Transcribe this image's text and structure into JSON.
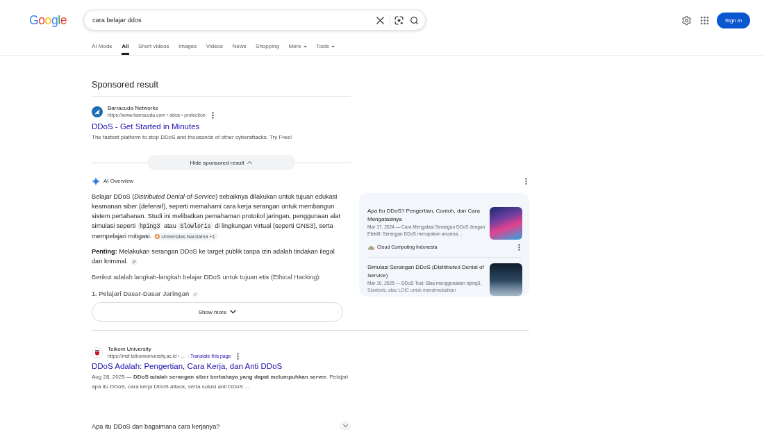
{
  "header": {
    "logo": "Google",
    "search": {
      "value": "cara belajar ddos"
    },
    "sign_in": "Sign in"
  },
  "tabs": [
    {
      "label": "AI Mode",
      "kind": "link",
      "selected": false
    },
    {
      "label": "All",
      "kind": "link",
      "selected": true
    },
    {
      "label": "Short videos",
      "kind": "link",
      "selected": false
    },
    {
      "label": "Images",
      "kind": "link",
      "selected": false
    },
    {
      "label": "Videos",
      "kind": "link",
      "selected": false
    },
    {
      "label": "News",
      "kind": "link",
      "selected": false
    },
    {
      "label": "Shopping",
      "kind": "link",
      "selected": false
    },
    {
      "label": "More",
      "kind": "menu",
      "selected": false
    },
    {
      "label": "Tools",
      "kind": "menu",
      "selected": false
    }
  ],
  "sponsored": {
    "heading": "Sponsored result",
    "ad": {
      "site": "Barracuda Networks",
      "url": "https://www.barracuda.com › ddos › protection",
      "title": "DDoS - Get Started in Minutes",
      "description": "The fastest platform to stop DDoS and thousands of other cyberattacks. Try Free!"
    },
    "hide_button": {
      "label": "Hide sponsored result",
      "expanded": true
    }
  },
  "ai_overview": {
    "title": "AI Overview",
    "expanded": false,
    "blocks": [
      {
        "kind": "paragraph",
        "cited": false,
        "parts": [
          {
            "kind": "text",
            "text": "Belajar DDoS (*Distributed Denial-of-Service*) sebaiknya dilakukan untuk tujuan edukasi keamanan siber (defensif), seperti memahami cara kerja serangan untuk membangun sistem pertahanan. Studi ini melibatkan pemahaman protokol jaringan, penggunaan alat simulasi seperti"
          },
          {
            "kind": "code",
            "text": "hping3"
          },
          {
            "kind": "text",
            "text": "atau"
          },
          {
            "kind": "code",
            "text": "Slowloris"
          },
          {
            "kind": "text",
            "text": "di lingkungan virtual (seperti GNS3), serta mempelajari mitigasi."
          },
          {
            "kind": "chip",
            "text": "Universitas Narotama +1"
          }
        ]
      },
      {
        "kind": "paragraph",
        "cited": true,
        "parts": [
          {
            "kind": "text",
            "text": "**Penting:** Melakukan serangan DDoS ke target publik tanpa izin adalah tindakan ilegal dan kriminal."
          }
        ]
      },
      {
        "kind": "paragraph",
        "cited": false,
        "parts": [
          {
            "kind": "text",
            "text": "Berikut adalah langkah-langkah belajar DDoS untuk tujuan etis (Ethical Hacking):"
          }
        ]
      },
      {
        "kind": "heading",
        "cited": true,
        "parts": [
          {
            "kind": "text",
            "text": "1. Pelajari Dasar-Dasar Jaringan"
          }
        ]
      }
    ],
    "show_more": "Show more",
    "sources": [
      {
        "title": "Apa Itu DDoS? Pengertian, Contoh, dan Cara Mengatasinya",
        "snippet": "Mar 17, 2024 — Cara Mengatasi Serangan DDoS dengan Efektif. Serangan DDoS merupakan ancama…",
        "site": "Cloud Computing Indonesia"
      },
      {
        "title": "Simulasi Serangan DDoS (Distributed Denial of Service)",
        "snippet": "Mar 10, 2025 — DDoS Tool: Bisa menggunakan hping3, Slowloris, atau LOIC untuk mensimulasikan"
      }
    ]
  },
  "results": [
    {
      "site": "Telkom University",
      "url": "https://msf.telkomuniversity.ac.id › ...",
      "translate": "· Translate this page",
      "title": "DDoS Adalah: Pengertian, Cara Kerja, dan Anti DDoS",
      "snippet": "Aug 28, 2025 — **DDoS adalah serangan siber berbahaya yang dapat melumpuhkan server**. Pelajari apa itu DDoS, cara kerja DDoS attack, serta solusi anti DDoS ..."
    }
  ],
  "related_questions": [
    {
      "question": "Apa itu DDoS dan bagaimana cara kerjanya?",
      "expanded": false
    }
  ]
}
